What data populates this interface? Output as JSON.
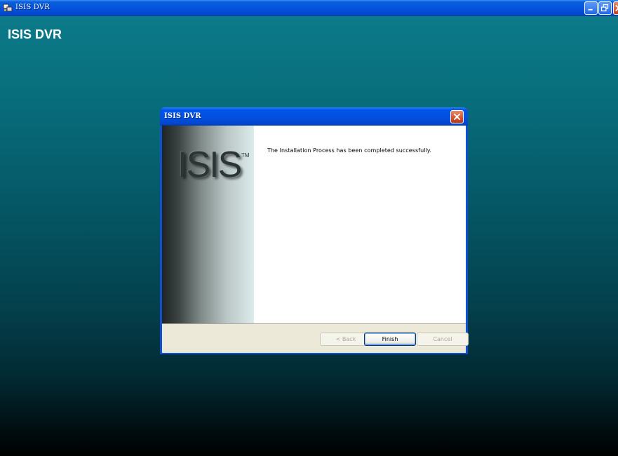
{
  "window": {
    "title": "ISIS DVR",
    "controls": [
      "minimize-icon",
      "restore-icon",
      "close-icon"
    ]
  },
  "app": {
    "heading": "ISIS DVR"
  },
  "dialog": {
    "title": "ISIS DVR",
    "logo_text": "ISIS",
    "logo_tm": "TM",
    "message": "The Installation Process has been completed successfully.",
    "buttons": {
      "back": "< Back",
      "finish": "Finish",
      "cancel": "Cancel"
    }
  },
  "colors": {
    "xp_blue": "#0454e0",
    "app_teal": "#0c7a89",
    "close_red": "#d5522b",
    "button_strip": "#ece9d8"
  }
}
